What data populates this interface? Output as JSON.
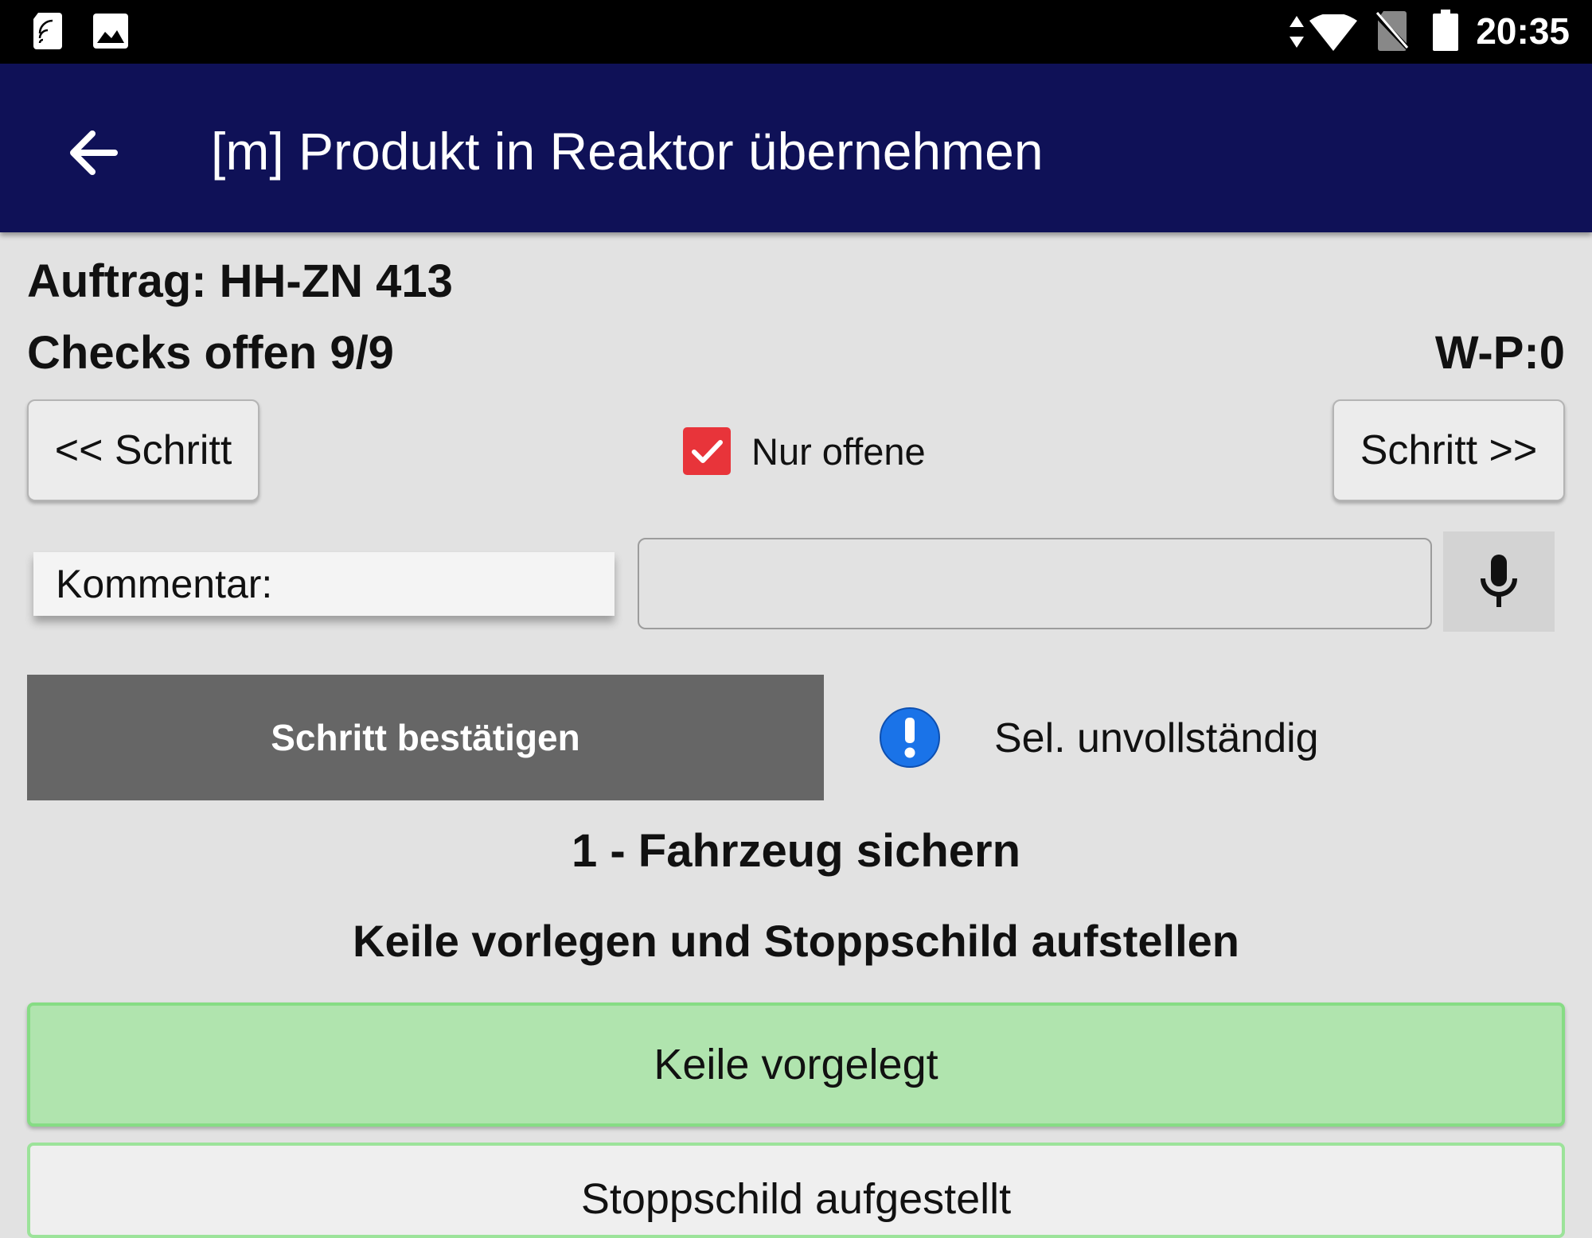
{
  "status_bar": {
    "time": "20:35",
    "icons": [
      "sd-card-icon",
      "image-icon",
      "data-arrows-icon",
      "wifi-icon",
      "no-sim-icon",
      "battery-icon"
    ]
  },
  "app_bar": {
    "title": "[m] Produkt in Reaktor übernehmen",
    "back_icon": "arrow-left-icon"
  },
  "order": {
    "label": "Auftrag: HH-ZN 413"
  },
  "checks": {
    "label": "Checks offen 9/9",
    "wp": "W-P:0"
  },
  "nav": {
    "prev_label": "<< Schritt",
    "next_label": "Schritt >>",
    "filter_label": "Nur offene",
    "filter_checked": true
  },
  "comment": {
    "label": "Kommentar:",
    "value": "",
    "mic_icon": "microphone-icon"
  },
  "confirm": {
    "button_label": "Schritt bestätigen",
    "status_icon": "info-exclamation-icon",
    "status_text": "Sel. unvollständig"
  },
  "step": {
    "title": "1 - Fahrzeug sichern",
    "instruction": "Keile vorlegen und Stoppschild aufstellen"
  },
  "options": [
    {
      "label": "Keile vorgelegt",
      "selected": true
    },
    {
      "label": "Stoppschild aufgestellt",
      "selected": false
    }
  ],
  "colors": {
    "app_bar": "#0f1157",
    "checkbox": "#e8343a",
    "option_selected": "#b0e4ae",
    "option_border": "#86dc84",
    "confirm_button": "#666666",
    "info_icon": "#1a73e8"
  }
}
